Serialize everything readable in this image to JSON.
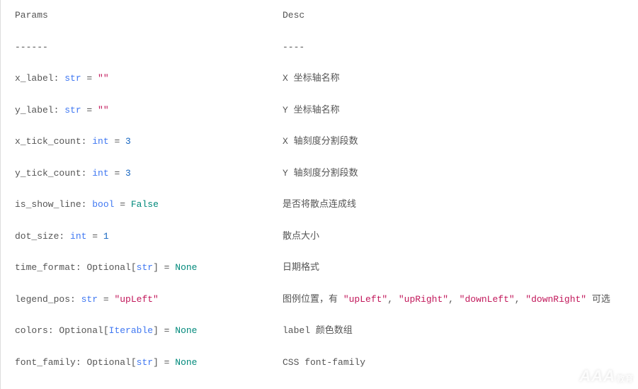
{
  "header": {
    "param_label": "Params",
    "desc_label": "Desc",
    "param_rule": "------",
    "desc_rule": "----"
  },
  "rows": [
    {
      "name": "x_label",
      "type_prefix": "",
      "type": "str",
      "type_suffix": "",
      "eq": " = ",
      "value": "\"\"",
      "value_kind": "str",
      "desc_parts": [
        "X 坐标轴名称"
      ]
    },
    {
      "name": "y_label",
      "type_prefix": "",
      "type": "str",
      "type_suffix": "",
      "eq": " = ",
      "value": "\"\"",
      "value_kind": "str",
      "desc_parts": [
        "Y 坐标轴名称"
      ]
    },
    {
      "name": "x_tick_count",
      "type_prefix": "",
      "type": "int",
      "type_suffix": "",
      "eq": " = ",
      "value": "3",
      "value_kind": "num",
      "desc_parts": [
        "X 轴刻度分割段数"
      ]
    },
    {
      "name": "y_tick_count",
      "type_prefix": "",
      "type": "int",
      "type_suffix": "",
      "eq": " = ",
      "value": "3",
      "value_kind": "num",
      "desc_parts": [
        "Y 轴刻度分割段数"
      ]
    },
    {
      "name": "is_show_line",
      "type_prefix": "",
      "type": "bool",
      "type_suffix": "",
      "eq": " = ",
      "value": "False",
      "value_kind": "bool",
      "desc_parts": [
        "是否将散点连成线"
      ]
    },
    {
      "name": "dot_size",
      "type_prefix": "",
      "type": "int",
      "type_suffix": "",
      "eq": " = ",
      "value": "1",
      "value_kind": "num",
      "desc_parts": [
        "散点大小"
      ]
    },
    {
      "name": "time_format",
      "type_prefix": "Optional[",
      "type": "str",
      "type_suffix": "]",
      "eq": " = ",
      "value": "None",
      "value_kind": "none",
      "desc_parts": [
        "日期格式"
      ]
    },
    {
      "name": "legend_pos",
      "type_prefix": "",
      "type": "str",
      "type_suffix": "",
      "eq": " = ",
      "value": "\"upLeft\"",
      "value_kind": "str",
      "desc_parts": [
        "图例位置，有 ",
        {
          "str": "\"upLeft\""
        },
        ", ",
        {
          "str": "\"upRight\""
        },
        ", ",
        {
          "str": "\"downLeft\""
        },
        ", ",
        {
          "str": "\"downRight\""
        },
        " 可选"
      ]
    },
    {
      "name": "colors",
      "type_prefix": "Optional[",
      "type": "Iterable",
      "type_suffix": "]",
      "eq": " = ",
      "value": "None",
      "value_kind": "none",
      "desc_parts": [
        "label 颜色数组"
      ]
    },
    {
      "name": "font_family",
      "type_prefix": "Optional[",
      "type": "str",
      "type_suffix": "]",
      "eq": " = ",
      "value": "None",
      "value_kind": "none",
      "desc_parts": [
        "CSS font-family"
      ]
    }
  ],
  "watermark": {
    "main": "AAA",
    "sub": "教育"
  }
}
